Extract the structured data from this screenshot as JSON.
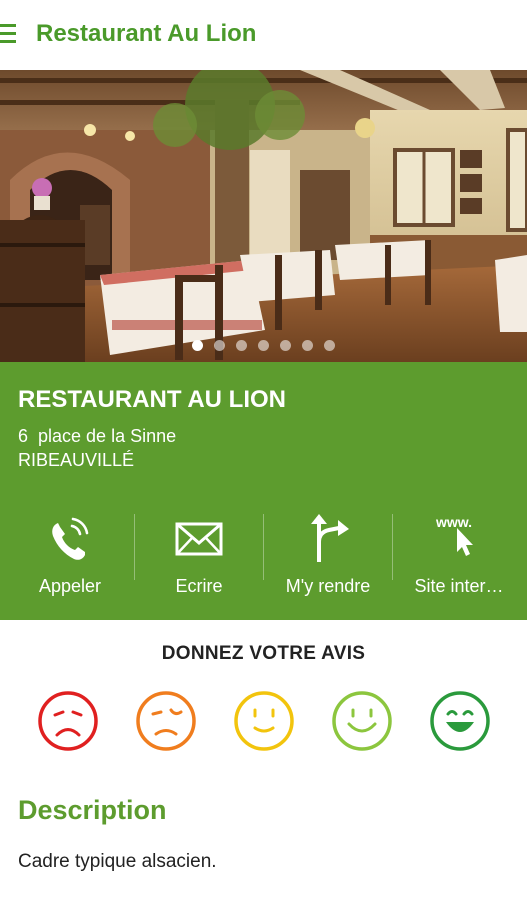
{
  "header": {
    "title": "Restaurant Au Lion",
    "menu_icon": "hamburger-menu-icon"
  },
  "gallery": {
    "image_count": 7,
    "active_index": 0
  },
  "restaurant": {
    "name": "RESTAURANT AU LION",
    "address_line": "6  place de la Sinne",
    "city": "RIBEAUVILLÉ"
  },
  "actions": [
    {
      "label": "Appeler",
      "icon": "phone-icon"
    },
    {
      "label": "Ecrire",
      "icon": "envelope-icon"
    },
    {
      "label": "M'y rendre",
      "icon": "directions-icon"
    },
    {
      "label": "Site inter…",
      "icon": "website-icon",
      "icon_text": "www."
    }
  ],
  "review": {
    "title": "DONNEZ VOTRE AVIS",
    "faces": [
      {
        "icon": "very-unhappy-face-icon",
        "color": "#e02020"
      },
      {
        "icon": "unhappy-face-icon",
        "color": "#f07d1e"
      },
      {
        "icon": "neutral-face-icon",
        "color": "#f2c40d"
      },
      {
        "icon": "happy-face-icon",
        "color": "#8cc63e"
      },
      {
        "icon": "very-happy-face-icon",
        "color": "#2a9a3c"
      }
    ]
  },
  "description": {
    "title": "Description",
    "text": "Cadre typique alsacien."
  },
  "colors": {
    "brand_green": "#4a9a2a",
    "panel_green": "#5d9c2e"
  }
}
